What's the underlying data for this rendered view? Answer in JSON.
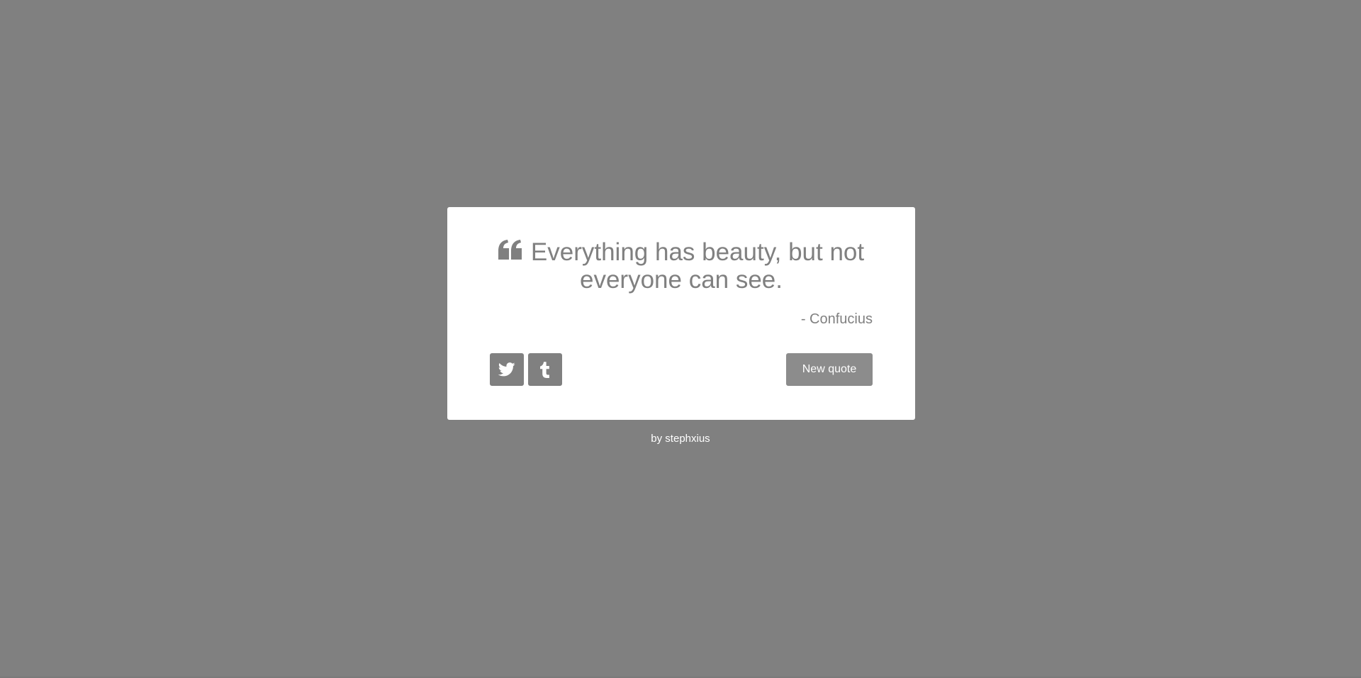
{
  "quote": {
    "text": "Everything has beauty, but not everyone can see.",
    "author": "- Confucius",
    "icon": "quote-left-icon"
  },
  "buttons": {
    "twitter_icon": "twitter-icon",
    "tumblr_icon": "tumblr-icon",
    "new_quote_label": "New quote"
  },
  "footer": {
    "credit": "by stephxius"
  },
  "colors": {
    "background": "#808080",
    "card": "#ffffff",
    "text": "#808080",
    "button": "#808080"
  }
}
